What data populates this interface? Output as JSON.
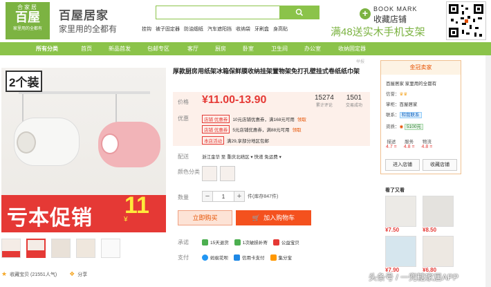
{
  "header": {
    "logo_top": "合家居",
    "logo_big": "百屋",
    "logo_sub": "家里用的全都有",
    "brand_name": "百屋居家",
    "brand_slogan": "家里用的全都有",
    "hot_links": [
      "挂钩",
      "被子固定器",
      "防油烟纸",
      "汽车遮阳挡",
      "收纳袋",
      "牙刷盒",
      "身高贴"
    ],
    "bookmark_en": "BOOK MARK",
    "bookmark_cn": "收藏店铺",
    "promo_text": "满48送实木手机支架",
    "accent_color": "#8bc34a"
  },
  "nav": {
    "items": [
      "所有分类",
      "首页",
      "新品首发",
      "包邮专区",
      "客厅",
      "厨房",
      "卧室",
      "卫生间",
      "办公室",
      "收纳固定器"
    ]
  },
  "gallery": {
    "tag": "2个装",
    "banner_text": "亏本促销",
    "banner_price": "11",
    "banner_currency": "¥",
    "fav_text": "收藏宝贝 (21551人气)",
    "share_text": "分享"
  },
  "product": {
    "title": "厚款厨房用纸架冰箱保鲜膜收纳挂架置物架免打孔壁挂式卷纸纸巾架",
    "price_label": "价格",
    "price": "¥11.00-13.90",
    "reviews_count": "15274",
    "reviews_label": "累计评论",
    "sales_count": "1501",
    "sales_label": "交易成功",
    "promo_label": "优惠",
    "coupons": [
      {
        "tag": "店铺 优惠券",
        "text": "10元店铺优惠券，满168元可用",
        "link": "领取"
      },
      {
        "tag": "店铺 优惠券",
        "text": "5元店铺优惠券，满88元可用",
        "link": "领取"
      },
      {
        "tag": "本店活动",
        "text": "满29,享部分地区包邮",
        "link": ""
      }
    ],
    "ship_label": "配送",
    "ship_value": "浙江金华 至 重庆北碚区 ▾  快递 免运费 ▾",
    "color_label": "颜色分类",
    "qty_label": "数量",
    "qty_minus": "−",
    "qty_value": "1",
    "qty_plus": "+",
    "stock": "件(库存847件)",
    "buy_now": "立即购买",
    "add_cart": "加入购物车",
    "promise_label": "承诺",
    "promises": [
      "15天退货",
      "1次破损补寄",
      "公益宝贝"
    ],
    "pay_label": "支付",
    "payments": [
      "蚂蚁花呗",
      "信用卡支付",
      "集分宝"
    ]
  },
  "seller": {
    "header": "金冠卖家",
    "shop_name": "百屋居家 家里用的全都有",
    "credit_label": "信誉：",
    "keeper_label": "掌柜：",
    "keeper_value": "百屋居家",
    "contact_label": "联系：",
    "contact_value": "和我联系",
    "qual_label": "资质：",
    "deposit": "5100元",
    "scores": [
      {
        "label": "描述",
        "value": "4.7 ="
      },
      {
        "label": "服务",
        "value": "4.8 ="
      },
      {
        "label": "物流",
        "value": "4.8 ="
      }
    ],
    "enter_shop": "进入店铺",
    "collect_shop": "收藏店铺"
  },
  "same_items": {
    "header": "看了又看",
    "prices": [
      "¥7.50",
      "¥8.50",
      "¥7.90",
      "¥6.80"
    ]
  },
  "misc": {
    "report": "举报",
    "watermark": "头条号 / 一兜糖家居APP"
  }
}
